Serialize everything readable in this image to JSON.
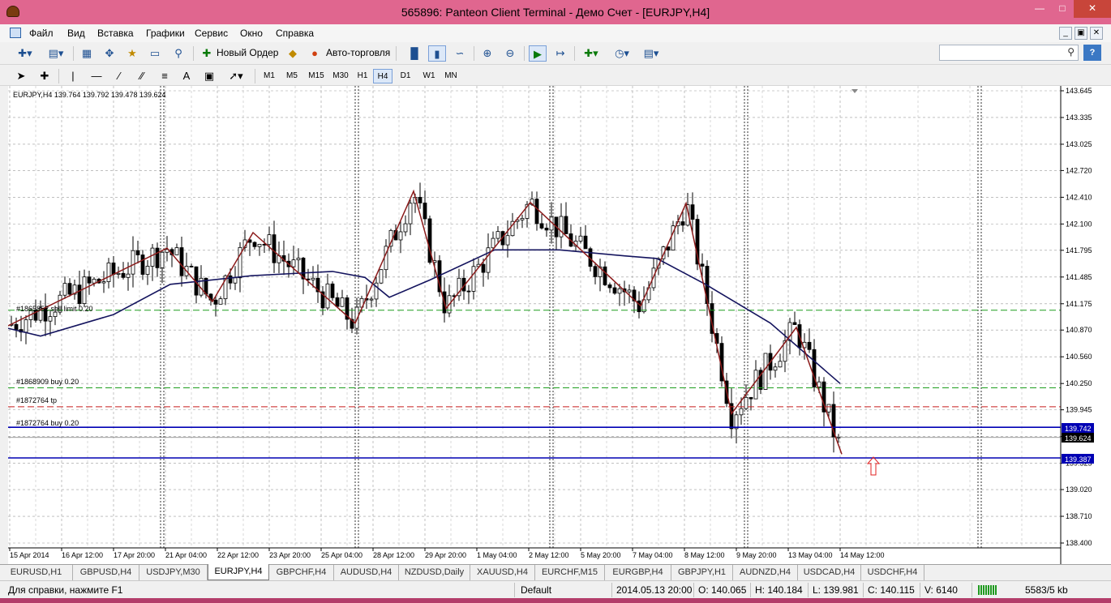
{
  "window": {
    "title": "565896: Panteon Client Terminal - Демо Счет - [EURJPY,H4]"
  },
  "menu": [
    "Файл",
    "Вид",
    "Вставка",
    "Графики",
    "Сервис",
    "Окно",
    "Справка"
  ],
  "toolbar": {
    "new_order": "Новый Ордер",
    "autotrading": "Авто-торговля"
  },
  "timeframes": [
    "M1",
    "M5",
    "M15",
    "M30",
    "H1",
    "H4",
    "D1",
    "W1",
    "MN"
  ],
  "active_timeframe": "H4",
  "drawing_tools": {
    "text_tool": "A"
  },
  "chart": {
    "header": "EURJPY,H4  139.764 139.792 139.478 139.624",
    "price_axis": [
      "143.645",
      "143.335",
      "143.025",
      "142.720",
      "142.410",
      "142.100",
      "141.795",
      "141.485",
      "141.175",
      "140.870",
      "140.560",
      "140.250",
      "139.945",
      "139.635",
      "139.325",
      "139.020",
      "138.710",
      "138.400"
    ],
    "time_axis": [
      "15 Apr 2014",
      "16 Apr 12:00",
      "17 Apr 20:00",
      "21 Apr 04:00",
      "22 Apr 12:00",
      "23 Apr 20:00",
      "25 Apr 04:00",
      "28 Apr 12:00",
      "29 Apr 20:00",
      "1 May 04:00",
      "2 May 12:00",
      "5 May 20:00",
      "7 May 04:00",
      "8 May 12:00",
      "9 May 20:00",
      "13 May 04:00",
      "14 May 12:00"
    ],
    "order_labels": {
      "sell_limit": "#1865852 sell limit 0.20",
      "buy1": "#1868909 buy 0.20",
      "tp": "#1872764 tp",
      "buy2": "#1872764 buy 0.20"
    },
    "price_tags": {
      "level1": "139.742",
      "current": "139.624",
      "level2": "139.387"
    },
    "colors": {
      "zigzag": "#8b1a1a",
      "ma": "#14145e",
      "level_line": "#0000b4",
      "sell_limit": "#1e9e1e",
      "tp": "#c81e1e"
    }
  },
  "chart_data": {
    "type": "candlestick",
    "symbol": "EURJPY",
    "timeframe": "H4",
    "ylim": [
      138.4,
      143.645
    ],
    "open": 139.764,
    "high": 139.792,
    "low": 139.478,
    "close": 139.624,
    "levels": [
      {
        "label": "#1865852 sell limit 0.20",
        "value": 141.1
      },
      {
        "label": "#1868909 buy 0.20",
        "value": 140.2
      },
      {
        "label": "#1872764 tp",
        "value": 139.98
      },
      {
        "label": "#1872764 buy 0.20",
        "value": 139.742
      },
      {
        "value": 139.387
      }
    ],
    "zigzag": [
      140.92,
      141.82,
      141.2,
      142.0,
      140.95,
      142.48,
      141.12,
      142.35,
      141.15,
      142.34,
      139.9,
      140.9,
      139.43
    ],
    "ma": [
      140.89,
      140.8,
      141.05,
      141.4,
      141.5,
      141.55,
      141.48,
      141.25,
      141.45,
      141.8,
      141.8,
      141.73,
      141.7,
      141.4,
      140.95,
      140.25
    ]
  },
  "tabs": [
    "EURUSD,H1",
    "GBPUSD,H4",
    "USDJPY,M30",
    "EURJPY,H4",
    "GBPCHF,H4",
    "AUDUSD,H4",
    "NZDUSD,Daily",
    "XAUUSD,H4",
    "EURCHF,M15",
    "EURGBP,H4",
    "GBPJPY,H1",
    "AUDNZD,H4",
    "USDCAD,H4",
    "USDCHF,H4"
  ],
  "active_tab": "EURJPY,H4",
  "status": {
    "help": "Для справки, нажмите F1",
    "profile": "Default",
    "datetime": "2014.05.13 20:00",
    "open": "O: 140.065",
    "high": "H: 140.184",
    "low": "L: 139.981",
    "close": "C: 140.115",
    "volume": "V: 6140",
    "traffic": "5583/5 kb"
  }
}
